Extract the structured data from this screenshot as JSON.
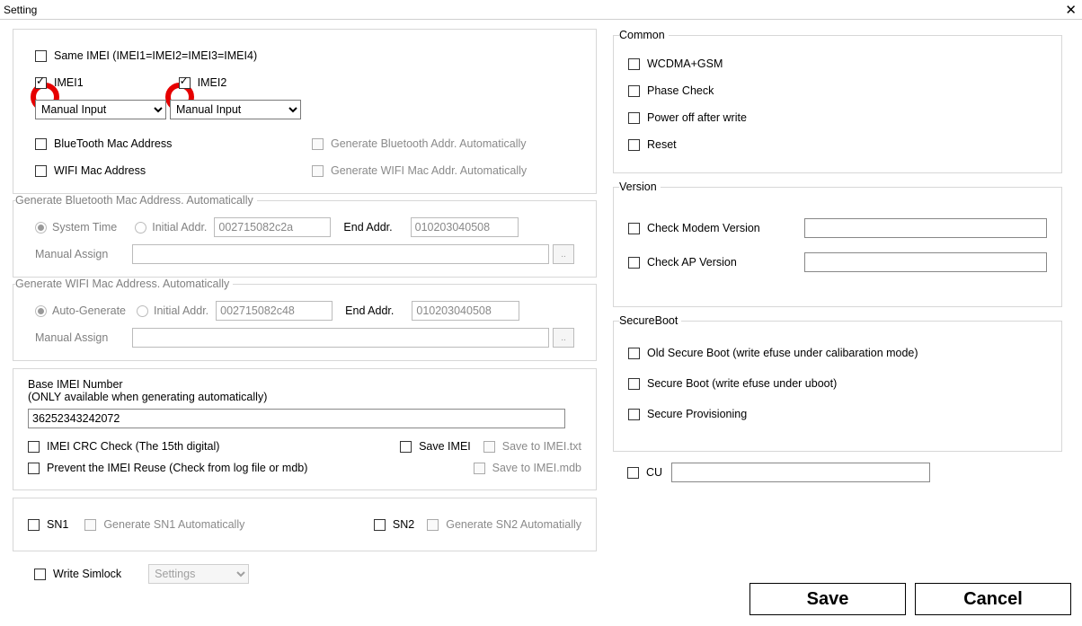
{
  "window": {
    "title": "Setting",
    "close": "✕"
  },
  "imei": {
    "same_label": "Same IMEI (IMEI1=IMEI2=IMEI3=IMEI4)",
    "imei1_label": "IMEI1",
    "imei2_label": "IMEI2",
    "sel1": "Manual Input",
    "sel2": "Manual Input",
    "bt_label": "BlueTooth Mac Address",
    "wifi_label": "WIFI Mac Address",
    "gen_bt_label": "Generate Bluetooth Addr. Automatically",
    "gen_wifi_label": "Generate WIFI Mac Addr. Automatically"
  },
  "gen_bt": {
    "legend": "Generate Bluetooth Mac Address. Automatically",
    "r1": "System Time",
    "r2": "Initial Addr.",
    "init_val": "002715082c2a",
    "end_label": "End Addr.",
    "end_val": "010203040508",
    "manual": "Manual Assign"
  },
  "gen_wifi": {
    "legend": "Generate WIFI Mac Address. Automatically",
    "r1": "Auto-Generate",
    "r2": "Initial Addr.",
    "init_val": "002715082c48",
    "end_label": "End Addr.",
    "end_val": "010203040508",
    "manual": "Manual Assign"
  },
  "base": {
    "l1": "Base IMEI Number",
    "l2": "(ONLY available when generating automatically)",
    "value": "36252343242072",
    "crc": "IMEI CRC Check (The 15th digital)",
    "save": "Save IMEI",
    "save_txt": "Save to IMEI.txt",
    "prevent": "Prevent the IMEI Reuse (Check from log file or mdb)",
    "save_mdb": "Save to IMEI.mdb"
  },
  "sn": {
    "sn1": "SN1",
    "gen1": "Generate SN1 Automatically",
    "sn2": "SN2",
    "gen2": "Generate SN2 Automatially"
  },
  "ws": {
    "label": "Write Simlock",
    "sel": "Settings"
  },
  "common": {
    "legend": "Common",
    "wcdma": "WCDMA+GSM",
    "phase": "Phase Check",
    "power": "Power off after write",
    "reset": "Reset"
  },
  "version": {
    "legend": "Version",
    "modem": "Check Modem Version",
    "ap": "Check AP Version"
  },
  "secure": {
    "legend": "SecureBoot",
    "old": "Old Secure Boot (write efuse under calibaration  mode)",
    "new": "Secure Boot (write efuse under uboot)",
    "prov": "Secure Provisioning"
  },
  "cu": {
    "label": "CU"
  },
  "buttons": {
    "save": "Save",
    "cancel": "Cancel"
  }
}
